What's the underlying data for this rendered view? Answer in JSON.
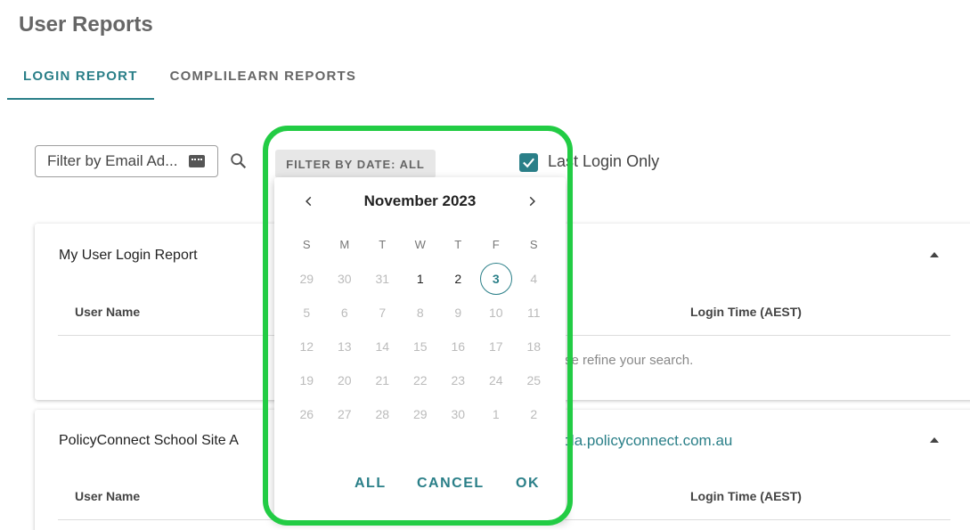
{
  "page": {
    "title": "User Reports"
  },
  "tabs": [
    {
      "label": "LOGIN REPORT",
      "active": true
    },
    {
      "label": "COMPLILEARN REPORTS",
      "active": false
    }
  ],
  "filter": {
    "email_value": "Filter by Email Ad...",
    "date_button": "FILTER BY DATE: ALL",
    "last_login_label": "Last Login Only",
    "last_login_checked": true
  },
  "cards": [
    {
      "title": "My User Login Report",
      "columns": [
        "User Name",
        "Login Time (AEST)"
      ],
      "message": "Please refine your search."
    },
    {
      "title": "PolicyConnect School Site A",
      "link": "https://policyconnectdemoschoola.policyconnect.com.au",
      "columns": [
        "User Name",
        "Login Time (AEST)"
      ]
    }
  ],
  "calendar": {
    "month_label": "November 2023",
    "weekdays": [
      "S",
      "M",
      "T",
      "W",
      "T",
      "F",
      "S"
    ],
    "weeks": [
      [
        "29",
        "30",
        "31",
        "1",
        "2",
        "3",
        "4"
      ],
      [
        "5",
        "6",
        "7",
        "8",
        "9",
        "10",
        "11"
      ],
      [
        "12",
        "13",
        "14",
        "15",
        "16",
        "17",
        "18"
      ],
      [
        "19",
        "20",
        "21",
        "22",
        "23",
        "24",
        "25"
      ],
      [
        "26",
        "27",
        "28",
        "29",
        "30",
        "1",
        "2"
      ]
    ],
    "enabled_days": [
      "1",
      "2"
    ],
    "today": "3",
    "actions": {
      "all": "ALL",
      "cancel": "CANCEL",
      "ok": "OK"
    }
  },
  "colors": {
    "accent": "#2a7f88",
    "highlight": "#22cc44"
  }
}
